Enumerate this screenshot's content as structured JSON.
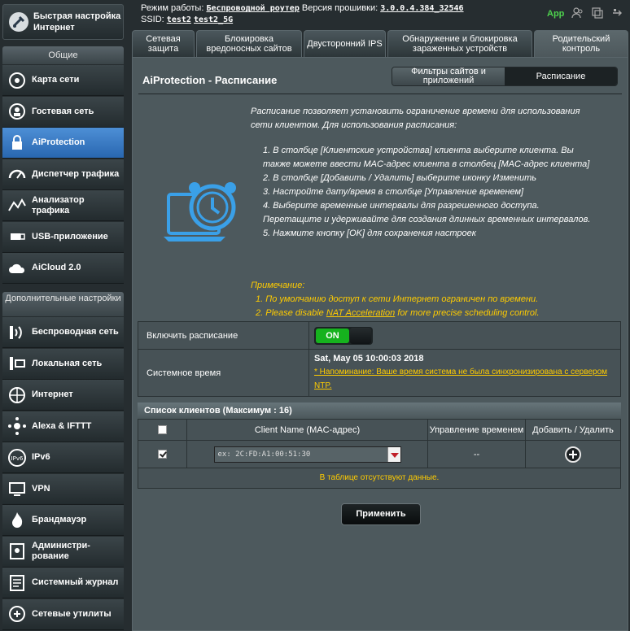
{
  "sidebar": {
    "quick_setup_label": "Быстрая настройка Интернет",
    "general_title": "Общие",
    "general_items": [
      {
        "label": "Карта сети",
        "icon": "network-map-icon"
      },
      {
        "label": "Гостевая сеть",
        "icon": "guest-network-icon"
      },
      {
        "label": "AiProtection",
        "icon": "aiprotection-lock-icon",
        "active": true
      },
      {
        "label": "Диспетчер трафика",
        "icon": "traffic-manager-icon"
      },
      {
        "label": "Анализатор трафика",
        "icon": "traffic-analyzer-icon"
      },
      {
        "label": "USB-приложение",
        "icon": "usb-icon"
      },
      {
        "label": "AiCloud 2.0",
        "icon": "cloud-icon"
      }
    ],
    "advanced_title": "Дополнительные настройки",
    "advanced_items": [
      {
        "label": "Беспроводная сеть",
        "icon": "wireless-icon"
      },
      {
        "label": "Локальная сеть",
        "icon": "lan-icon"
      },
      {
        "label": "Интернет",
        "icon": "globe-icon"
      },
      {
        "label": "Alexa & IFTTT",
        "icon": "alexa-icon"
      },
      {
        "label": "IPv6",
        "icon": "ipv6-icon"
      },
      {
        "label": "VPN",
        "icon": "vpn-icon"
      },
      {
        "label": "Брандмауэр",
        "icon": "firewall-icon"
      },
      {
        "label": "Администри-рование",
        "icon": "admin-icon"
      },
      {
        "label": "Системный журнал",
        "icon": "system-log-icon"
      },
      {
        "label": "Сетевые утилиты",
        "icon": "network-tools-icon"
      }
    ]
  },
  "header": {
    "mode_label": "Режим работы:",
    "mode_value": "Беспроводной роутер",
    "firmware_label": "Версия прошивки:",
    "firmware_value": "3.0.0.4.384_32546",
    "ssid_label": "SSID:",
    "ssid_1": "test2",
    "ssid_2": "test2_5G",
    "app_label": "App"
  },
  "tabs": [
    {
      "label": "Сетевая защита"
    },
    {
      "label": "Блокировка вредоносных сайтов"
    },
    {
      "label": "Двусторонний IPS"
    },
    {
      "label": "Обнаружение и блокировка зараженных устройств"
    },
    {
      "label": "Родительский контроль",
      "active": true
    }
  ],
  "main": {
    "title": "AiProtection - Расписание",
    "subtab_filters": "Фильтры сайтов и приложений",
    "subtab_schedule": "Расписание",
    "description": "Расписание позволяет установить ограничение времени для использования сети клиентом. Для использования расписания:",
    "steps": [
      "1. В столбце [Клиентские устройства] клиента выберите клиента. Вы также можете ввести MAC-адрес клиента в столбец [MAC-адрес клиента]",
      "2. В столбце [Добавить / Удалить] выберите иконку Изменить",
      "3. Настройте дату/время в столбце [Управление временем]",
      "4. Выберите временные интервалы для разрешенного доступа. Перетащите и удерживайте для создания длинных временных интервалов.",
      "5. Нажмите кнопку [OK] для сохранения настроек"
    ],
    "note_title": "Примечание:",
    "note_1": "1. По умолчанию доступ к сети Интернет ограничен по времени.",
    "note_2_prefix": "2. Please disable ",
    "note_2_link": "NAT Acceleration",
    "note_2_suffix": " for more precise scheduling control.",
    "enable_label": "Включить расписание",
    "enable_value": "ON",
    "system_time_label": "Системное время",
    "system_time_value": "Sat, May 05 10:00:03 2018",
    "system_time_warning": "* Напоминание: Ваше время система не была синхронизирована с сервером NTP.",
    "client_list_title": "Список клиентов (Максимум : 16)",
    "col_client": "Client Name (MAC-адрес)",
    "col_time": "Управление временем",
    "col_add": "Добавить / Удалить",
    "mac_placeholder": "ex: 2C:FD:A1:00:51:30",
    "time_value": "--",
    "no_data": "В таблице отсутствуют данные.",
    "apply_label": "Применить"
  }
}
